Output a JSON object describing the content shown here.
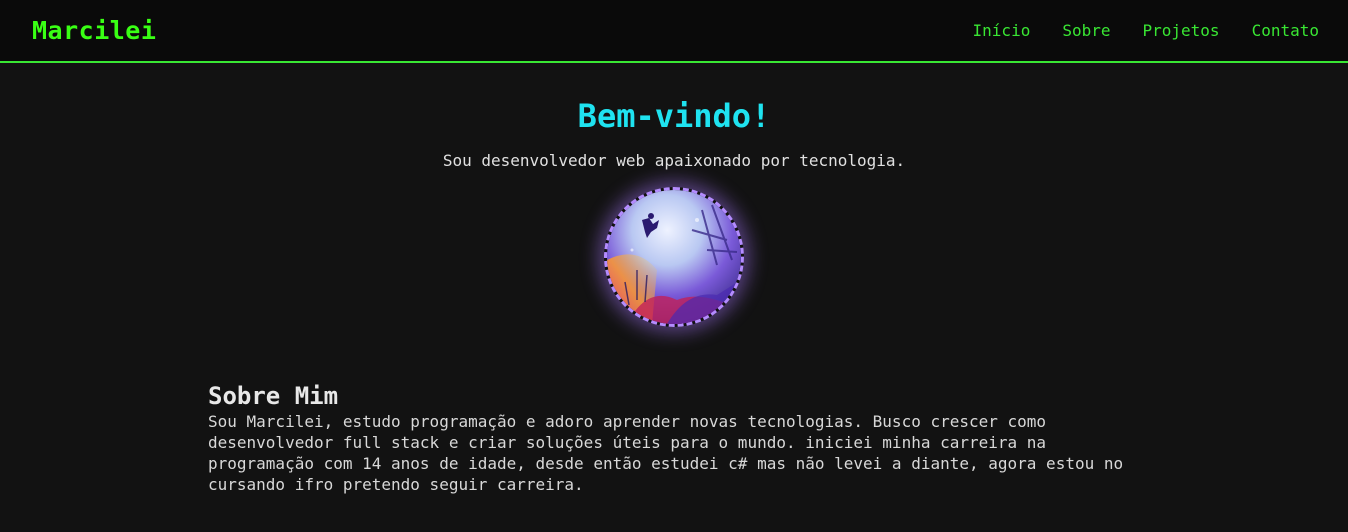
{
  "header": {
    "brand": "Marcilei",
    "nav": [
      "Início",
      "Sobre",
      "Projetos",
      "Contato"
    ]
  },
  "hero": {
    "title": "Bem-vindo!",
    "subtitle": "Sou desenvolvedor web apaixonado por tecnologia."
  },
  "about": {
    "title": "Sobre Mim",
    "text": "Sou Marcilei, estudo programação e adoro aprender novas tecnologias. Busco crescer como desenvolvedor full stack e criar soluções úteis para o mundo. iniciei minha carreira na programação com 14 anos de idade, desde então estudei c# mas não levei a diante, agora estou no cursando ifro pretendo seguir carreira."
  },
  "colors": {
    "accent_green": "#39ff14",
    "title_cyan": "#1fe3f0",
    "avatar_border": "#b48cff",
    "background": "#121212"
  }
}
